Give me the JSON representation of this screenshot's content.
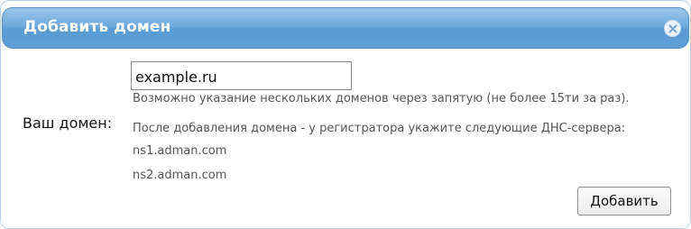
{
  "dialog": {
    "title": "Добавить домен",
    "close_icon": "close-icon"
  },
  "form": {
    "domain_label": "Ваш домен:",
    "domain_value": "example.ru",
    "hint_multiple": "Возможно указание нескольких доменов через запятую (не более 15ти за раз).",
    "hint_dns": "После добавления домена - у регистратора укажите следующие ДНС-сервера:",
    "nameservers": [
      "ns1.adman.com",
      "ns2.adman.com"
    ],
    "submit_label": "Добавить"
  },
  "colors": {
    "titlebar": "#6ea9dc",
    "title_text": "#ffffff",
    "hint_text": "#555555"
  }
}
